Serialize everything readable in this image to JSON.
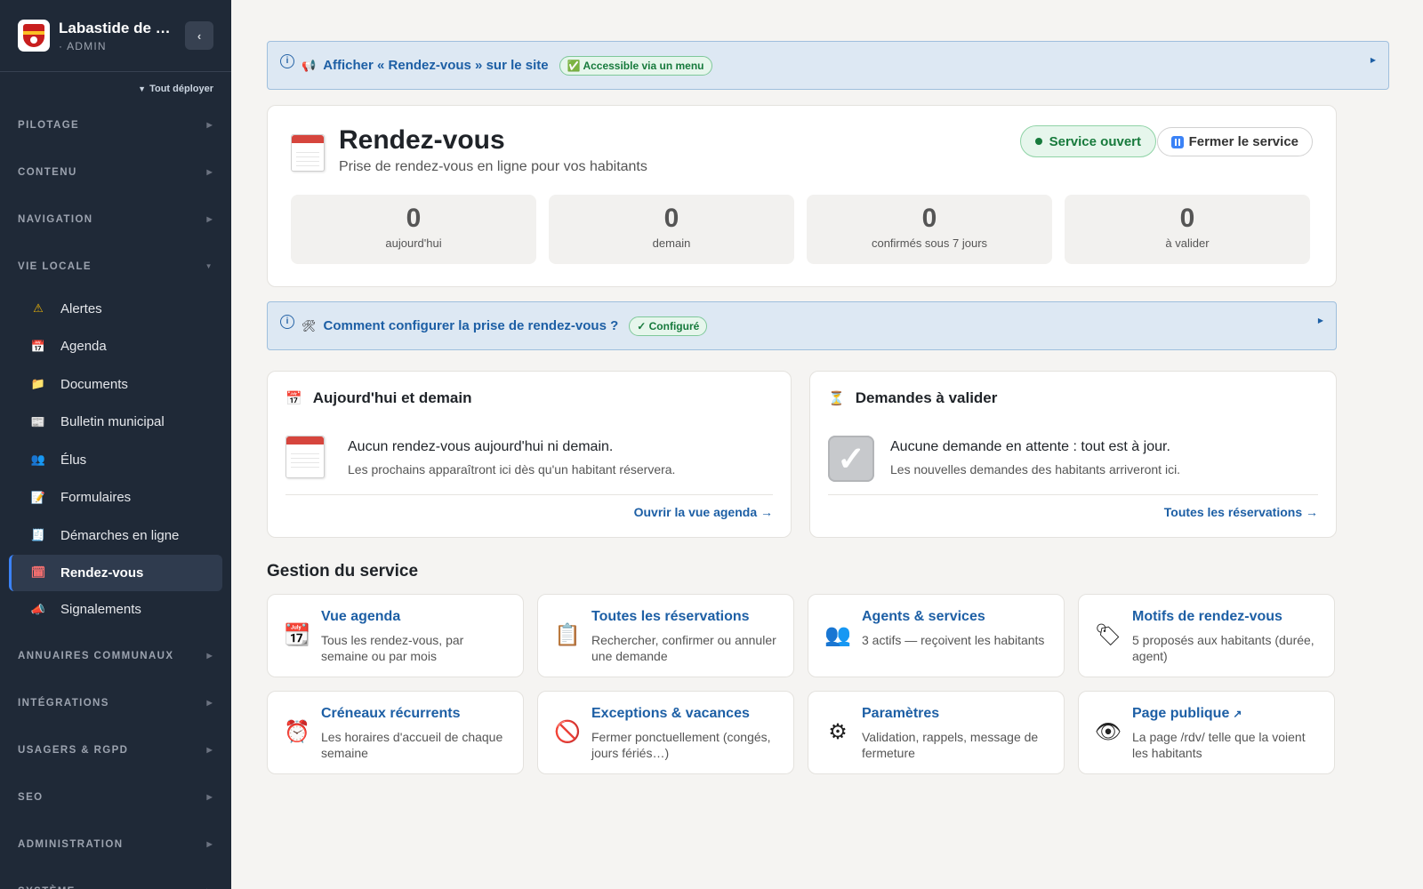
{
  "brand": {
    "title": "Labastide de M...",
    "subtitle": "· ADMIN"
  },
  "sidebar": {
    "expand_all": "Tout déployer",
    "sections_top": [
      "PILOTAGE",
      "CONTENU",
      "NAVIGATION"
    ],
    "open_section": "VIE LOCALE",
    "items": [
      {
        "label": "Alertes",
        "icon": "warning-icon",
        "glyph": "⚠",
        "color": "#eab308"
      },
      {
        "label": "Agenda",
        "icon": "calendar-icon",
        "glyph": "📅",
        "color": "#d6453d"
      },
      {
        "label": "Documents",
        "icon": "folder-icon",
        "glyph": "📁",
        "color": "#9ca3af"
      },
      {
        "label": "Bulletin municipal",
        "icon": "newspaper-icon",
        "glyph": "📰",
        "color": "#9ca3af"
      },
      {
        "label": "Élus",
        "icon": "people-icon",
        "glyph": "👥",
        "color": "#60a5fa"
      },
      {
        "label": "Formulaires",
        "icon": "memo-icon",
        "glyph": "📝",
        "color": "#fbbf24"
      },
      {
        "label": "Démarches en ligne",
        "icon": "receipt-icon",
        "glyph": "🧾",
        "color": "#d1d5db"
      },
      {
        "label": "Rendez-vous",
        "icon": "calendar-icon",
        "glyph": "🗓",
        "color": "#f87171",
        "active": true
      },
      {
        "label": "Signalements",
        "icon": "megaphone-icon",
        "glyph": "📣",
        "color": "#fbbf24"
      }
    ],
    "sections_bottom": [
      "ANNUAIRES COMMUNAUX",
      "INTÉGRATIONS",
      "USAGERS & RGPD",
      "SEO",
      "ADMINISTRATION",
      "SYSTÈME"
    ]
  },
  "banner_site": {
    "icon": "megaphone-icon",
    "text": "Afficher « Rendez-vous » sur le site",
    "badge": "✅ Accessible via un menu"
  },
  "hero": {
    "title": "Rendez-vous",
    "subtitle": "Prise de rendez-vous en ligne pour vos habitants",
    "status": "Service ouvert",
    "close_label": "Fermer le service",
    "stats": [
      {
        "value": "0",
        "label": "aujourd'hui"
      },
      {
        "value": "0",
        "label": "demain"
      },
      {
        "value": "0",
        "label": "confirmés sous 7 jours"
      },
      {
        "value": "0",
        "label": "à valider"
      }
    ]
  },
  "banner_config": {
    "icon": "tools-icon",
    "text": "Comment configurer la prise de rendez-vous ?",
    "badge": "✓ Configuré"
  },
  "panel_today": {
    "title": "Aujourd'hui et demain",
    "empty_main": "Aucun rendez-vous aujourd'hui ni demain.",
    "empty_sub": "Les prochains apparaîtront ici dès qu'un habitant réservera.",
    "link": "Ouvrir la vue agenda →"
  },
  "panel_pending": {
    "title": "Demandes à valider",
    "empty_main": "Aucune demande en attente : tout est à jour.",
    "empty_sub": "Les nouvelles demandes des habitants arriveront ici.",
    "link": "Toutes les réservations →"
  },
  "management": {
    "title": "Gestion du service",
    "tiles": [
      {
        "title": "Vue agenda",
        "desc": "Tous les rendez-vous, par semaine ou par mois",
        "icon": "calendar-icon",
        "glyph": "📆"
      },
      {
        "title": "Toutes les réservations",
        "desc": "Rechercher, confirmer ou annuler une demande",
        "icon": "clipboard-icon",
        "glyph": "📋"
      },
      {
        "title": "Agents & services",
        "desc": "3 actifs — reçoivent les habitants",
        "icon": "people-icon",
        "glyph": "👥"
      },
      {
        "title": "Motifs de rendez-vous",
        "desc": "5 proposés aux habitants (durée, agent)",
        "icon": "tag-icon",
        "glyph": "🏷"
      },
      {
        "title": "Créneaux récurrents",
        "desc": "Les horaires d'accueil de chaque semaine",
        "icon": "alarm-clock-icon",
        "glyph": "⏰"
      },
      {
        "title": "Exceptions & vacances",
        "desc": "Fermer ponctuellement (congés, jours fériés…)",
        "icon": "prohibited-icon",
        "glyph": "🚫"
      },
      {
        "title": "Paramètres",
        "desc": "Validation, rappels, message de fermeture",
        "icon": "gear-icon",
        "glyph": "⚙"
      },
      {
        "title": "Page publique",
        "desc": "La page /rdv/ telle que la voient les habitants",
        "icon": "eye-icon",
        "glyph": "👁",
        "external": "↗"
      }
    ]
  }
}
